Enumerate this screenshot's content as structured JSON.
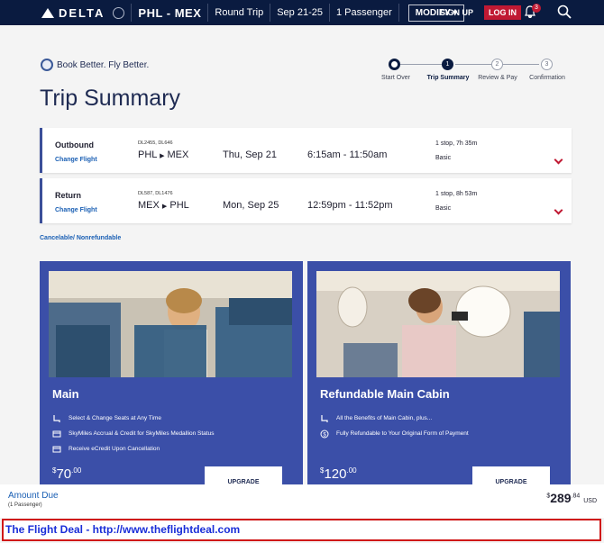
{
  "header": {
    "brand": "DELTA",
    "route": "PHL - MEX",
    "trip_type": "Round Trip",
    "dates": "Sep 21-25",
    "passengers": "1 Passenger",
    "modify_label": "MODIFY",
    "signup_label": "SIGN UP",
    "login_label": "LOG IN",
    "notification_count": "3"
  },
  "book_better": "Book Better. Fly Better.",
  "page_title": "Trip Summary",
  "steps": [
    {
      "num": "",
      "label": "Start Over"
    },
    {
      "num": "1",
      "label": "Trip Summary"
    },
    {
      "num": "2",
      "label": "Review & Pay"
    },
    {
      "num": "3",
      "label": "Confirmation"
    }
  ],
  "flights": [
    {
      "direction": "Outbound",
      "change": "Change Flight",
      "flight_numbers": "DL2455, DL646",
      "from": "PHL",
      "to": "MEX",
      "date": "Thu, Sep 21",
      "time": "6:15am - 11:50am",
      "stops": "1 stop, 7h 35m",
      "class": "Basic"
    },
    {
      "direction": "Return",
      "change": "Change Flight",
      "flight_numbers": "DL587, DL1476",
      "from": "MEX",
      "to": "PHL",
      "date": "Mon, Sep 25",
      "time": "12:59pm - 11:52pm",
      "stops": "1 stop, 8h 53m",
      "class": "Basic"
    }
  ],
  "cancel_note": "Cancelable/ Nonrefundable",
  "fares": [
    {
      "title": "Main",
      "features": [
        "Select & Change Seats at Any Time",
        "SkyMiles Accrual & Credit for SkyMiles Medallion Status",
        "Receive eCredit Upon Cancellation"
      ],
      "price_dollars": "70",
      "price_cents": ".00",
      "upgrade_label": "UPGRADE"
    },
    {
      "title": "Refundable Main Cabin",
      "features": [
        "All the Benefits of Main Cabin, plus...",
        "Fully Refundable to Your Original Form of Payment"
      ],
      "price_dollars": "120",
      "price_cents": ".00",
      "upgrade_label": "UPGRADE"
    }
  ],
  "amount_due": {
    "label": "Amount Due",
    "passengers": "(1 Passenger)",
    "currency_symbol": "$",
    "dollars": "289",
    "cents": ".84",
    "currency": "USD"
  },
  "banner": "The Flight Deal - http://www.theflightdeal.com"
}
